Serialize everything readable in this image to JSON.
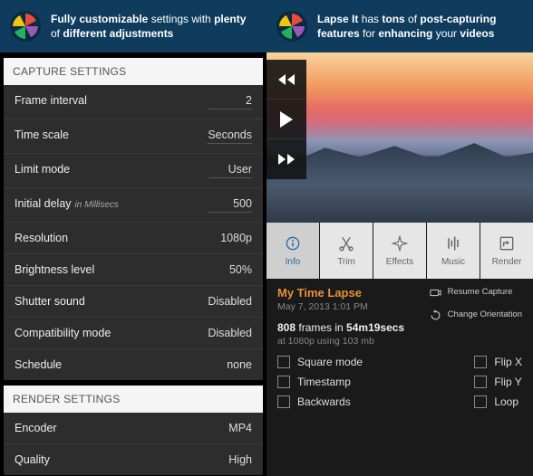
{
  "leftBanner": {
    "pre": "Fully customizable",
    "mid": " settings with ",
    "b2": "plenty",
    "mid2": " of ",
    "b3": "different adjustments"
  },
  "rightBanner": {
    "b1": "Lapse It",
    "t1": " has ",
    "b2": "tons",
    "t2": " of ",
    "b3": "post-capturing features",
    "t3": " for ",
    "b4": "enhancing",
    "t4": " your ",
    "b5": "videos"
  },
  "capture": {
    "header": "CAPTURE SETTINGS",
    "rows": [
      {
        "label": "Frame interval",
        "value": "2",
        "underline": true
      },
      {
        "label": "Time scale",
        "value": "Seconds",
        "underline": true
      },
      {
        "label": "Limit mode",
        "value": "User",
        "underline": true
      },
      {
        "label": "Initial delay",
        "sub": "in Millisecs",
        "value": "500",
        "underline": true
      },
      {
        "label": "Resolution",
        "value": "1080p"
      },
      {
        "label": "Brightness level",
        "value": "50%"
      },
      {
        "label": "Shutter sound",
        "value": "Disabled"
      },
      {
        "label": "Compatibility mode",
        "value": "Disabled"
      },
      {
        "label": "Schedule",
        "value": "none"
      }
    ]
  },
  "render": {
    "header": "RENDER SETTINGS",
    "rows": [
      {
        "label": "Encoder",
        "value": "MP4"
      },
      {
        "label": "Quality",
        "value": "High"
      }
    ]
  },
  "tools": [
    {
      "id": "info",
      "label": "Info",
      "active": true
    },
    {
      "id": "trim",
      "label": "Trim"
    },
    {
      "id": "effects",
      "label": "Effects"
    },
    {
      "id": "music",
      "label": "Music"
    },
    {
      "id": "render",
      "label": "Render"
    }
  ],
  "project": {
    "title": "My Time Lapse",
    "date": "May 7, 2013 1:01 PM",
    "framesN": "808",
    "framesT": " frames in ",
    "duration": "54m19secs",
    "subline": "at 1080p using 103 mb"
  },
  "sideActions": {
    "resume": "Resume Capture",
    "orient": "Change Orientation"
  },
  "checks": {
    "col1": [
      "Square mode",
      "Timestamp",
      "Backwards"
    ],
    "col2": [
      "Flip X",
      "Flip Y",
      "Loop"
    ]
  }
}
